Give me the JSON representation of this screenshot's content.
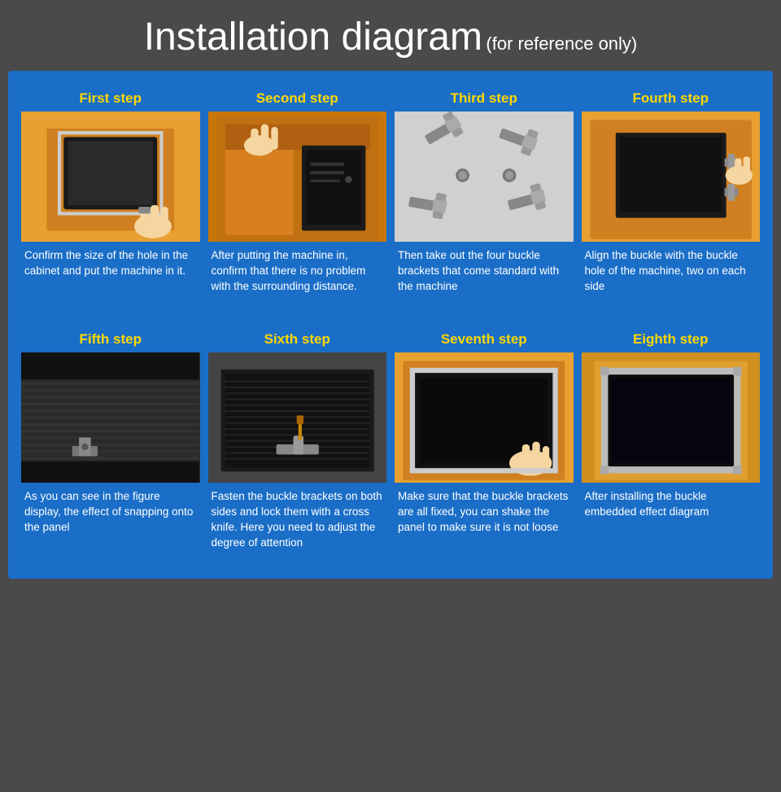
{
  "header": {
    "title": "Installation diagram",
    "subtitle": "(for reference only)"
  },
  "rows": [
    {
      "steps": [
        {
          "id": "step1",
          "title": "First step",
          "description": "Confirm the size of the hole in the cabinet and put the machine in it.",
          "img_bg": "#e8a030",
          "img_label": "step1-image"
        },
        {
          "id": "step2",
          "title": "Second step",
          "description": "After putting the machine in, confirm that there is no problem with the surrounding distance.",
          "img_bg": "#b06010",
          "img_label": "step2-image"
        },
        {
          "id": "step3",
          "title": "Third step",
          "description": "Then take out the four buckle brackets that come standard with the machine",
          "img_bg": "#c8c8c8",
          "img_label": "step3-image"
        },
        {
          "id": "step4",
          "title": "Fourth step",
          "description": "Align the buckle with the buckle hole of the machine, two on each side",
          "img_bg": "#e8a030",
          "img_label": "step4-image"
        }
      ]
    },
    {
      "steps": [
        {
          "id": "step5",
          "title": "Fifth step",
          "description": "As you can see in the figure display, the effect of snapping onto the panel",
          "img_bg": "#2a2a2a",
          "img_label": "step5-image"
        },
        {
          "id": "step6",
          "title": "Sixth step",
          "description": "Fasten the buckle brackets on both sides and lock them with a cross knife. Here you need to adjust the degree of attention",
          "img_bg": "#3a3a3a",
          "img_label": "step6-image"
        },
        {
          "id": "step7",
          "title": "Seventh step",
          "description": "Make sure that the buckle brackets are all fixed, you can shake the panel to make sure it is not loose",
          "img_bg": "#e8a030",
          "img_label": "step7-image"
        },
        {
          "id": "step8",
          "title": "Eighth step",
          "description": "After installing the buckle embedded effect diagram",
          "img_bg": "#d09020",
          "img_label": "step8-image"
        }
      ]
    }
  ]
}
